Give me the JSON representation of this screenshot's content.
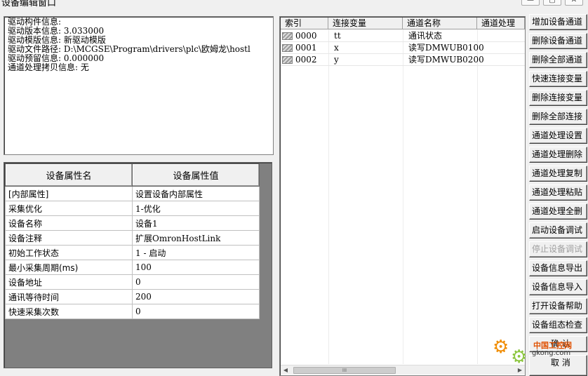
{
  "window": {
    "title": "设备编辑窗口",
    "controls": [
      "—",
      "▢",
      "✕"
    ]
  },
  "driver_info": {
    "lines": [
      "驱动构件信息:",
      "驱动版本信息: 3.033000",
      "驱动模版信息: 新驱动模版",
      "驱动文件路径: D:\\MCGSE\\Program\\drivers\\plc\\欧姆龙\\hostl",
      "驱动预留信息: 0.000000",
      "通道处理拷贝信息: 无"
    ]
  },
  "properties": {
    "headers": [
      "设备属性名",
      "设备属性值"
    ],
    "rows": [
      {
        "name": "[内部属性]",
        "value": "设置设备内部属性"
      },
      {
        "name": "采集优化",
        "value": "1-优化"
      },
      {
        "name": "设备名称",
        "value": "设备1"
      },
      {
        "name": "设备注释",
        "value": "扩展OmronHostLink"
      },
      {
        "name": "初始工作状态",
        "value": "1 - 启动"
      },
      {
        "name": "最小采集周期(ms)",
        "value": "100"
      },
      {
        "name": "设备地址",
        "value": "0"
      },
      {
        "name": "通讯等待时间",
        "value": "200"
      },
      {
        "name": "快速采集次数",
        "value": "0"
      }
    ]
  },
  "channels": {
    "headers": [
      "索引",
      "连接变量",
      "通道名称",
      "通道处理"
    ],
    "rows": [
      {
        "index": "0000",
        "variable": "tt",
        "name": "通讯状态",
        "process": ""
      },
      {
        "index": "0001",
        "variable": "x",
        "name": "读写DMWUB0100",
        "process": ""
      },
      {
        "index": "0002",
        "variable": "y",
        "name": "读写DMWUB0200",
        "process": ""
      }
    ],
    "scroll_thumb": "III"
  },
  "buttons": [
    {
      "label": "增加设备通道",
      "enabled": true
    },
    {
      "label": "删除设备通道",
      "enabled": true
    },
    {
      "label": "删除全部通道",
      "enabled": true
    },
    {
      "label": "快速连接变量",
      "enabled": true
    },
    {
      "label": "删除连接变量",
      "enabled": true
    },
    {
      "label": "删除全部连接",
      "enabled": true
    },
    {
      "label": "通道处理设置",
      "enabled": true
    },
    {
      "label": "通道处理删除",
      "enabled": true
    },
    {
      "label": "通道处理复制",
      "enabled": true
    },
    {
      "label": "通道处理粘贴",
      "enabled": true
    },
    {
      "label": "通道处理全删",
      "enabled": true
    },
    {
      "label": "启动设备调试",
      "enabled": true
    },
    {
      "label": "停止设备调试",
      "enabled": false
    },
    {
      "label": "设备信息导出",
      "enabled": true
    },
    {
      "label": "设备信息导入",
      "enabled": true
    },
    {
      "label": "打开设备帮助",
      "enabled": true
    },
    {
      "label": "设备组态检查",
      "enabled": true
    },
    {
      "label": "确 认",
      "enabled": true
    },
    {
      "label": "取 消",
      "enabled": true
    }
  ],
  "watermark": {
    "text": "中国工控网",
    "url": "gkong.com"
  }
}
